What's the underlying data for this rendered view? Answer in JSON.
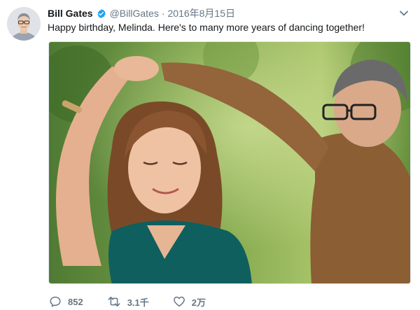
{
  "tweet": {
    "author_name": "Bill Gates",
    "handle": "@BillGates",
    "separator": "·",
    "date": "2016年8月15日",
    "text": "Happy birthday, Melinda. Here's to many more years of dancing together!",
    "media": {
      "kind": "photo"
    },
    "actions": {
      "reply_count": "852",
      "retweet_count": "3.1千",
      "like_count": "2万"
    },
    "icons": {
      "verified": "verified-badge-icon",
      "menu": "chevron-down-icon",
      "reply": "reply-icon",
      "retweet": "retweet-icon",
      "like": "heart-icon"
    },
    "colors": {
      "name": "#14171a",
      "secondary": "#657786",
      "verified": "#1da1f2"
    }
  }
}
